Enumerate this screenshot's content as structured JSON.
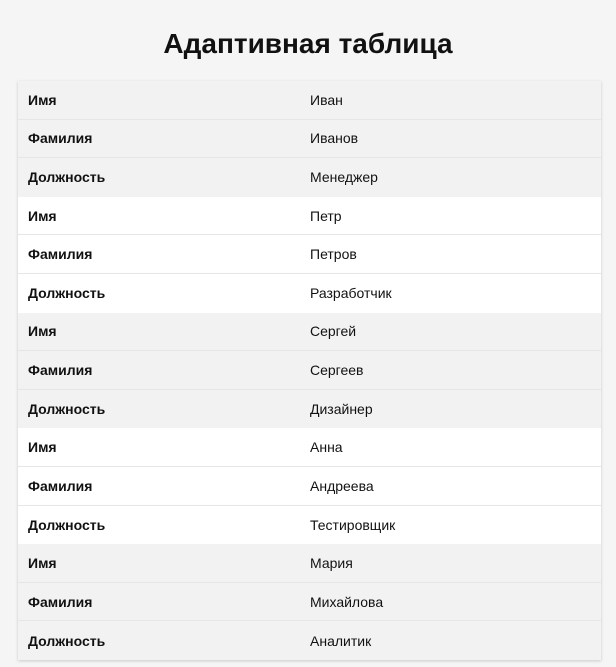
{
  "title": "Адаптивная таблица",
  "records": [
    {
      "rows": [
        {
          "label": "Имя",
          "value": "Иван"
        },
        {
          "label": "Фамилия",
          "value": "Иванов"
        },
        {
          "label": "Должность",
          "value": "Менеджер"
        }
      ]
    },
    {
      "rows": [
        {
          "label": "Имя",
          "value": "Петр"
        },
        {
          "label": "Фамилия",
          "value": "Петров"
        },
        {
          "label": "Должность",
          "value": "Разработчик"
        }
      ]
    },
    {
      "rows": [
        {
          "label": "Имя",
          "value": "Сергей"
        },
        {
          "label": "Фамилия",
          "value": "Сергеев"
        },
        {
          "label": "Должность",
          "value": "Дизайнер"
        }
      ]
    },
    {
      "rows": [
        {
          "label": "Имя",
          "value": "Анна"
        },
        {
          "label": "Фамилия",
          "value": "Андреева"
        },
        {
          "label": "Должность",
          "value": "Тестировщик"
        }
      ]
    },
    {
      "rows": [
        {
          "label": "Имя",
          "value": "Мария"
        },
        {
          "label": "Фамилия",
          "value": "Михайлова"
        },
        {
          "label": "Должность",
          "value": "Аналитик"
        }
      ]
    }
  ],
  "colors": {
    "page_background": "#f5f5f5",
    "row_shaded": "#f2f2f2",
    "row_plain": "#ffffff",
    "text": "#111111"
  }
}
